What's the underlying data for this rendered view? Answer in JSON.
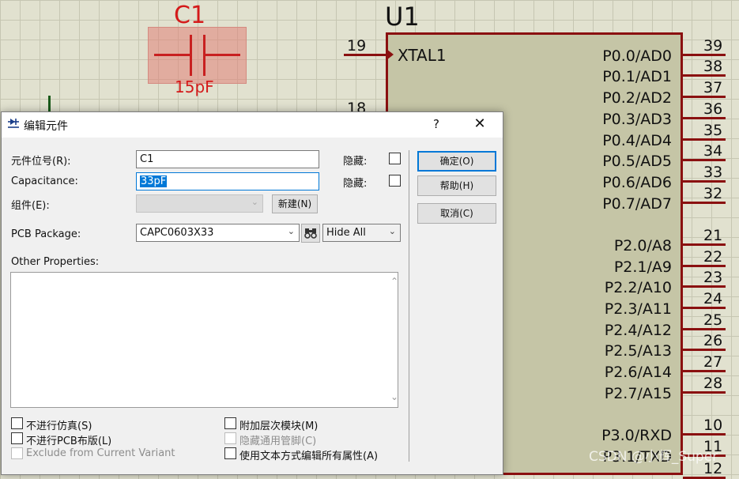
{
  "schematic": {
    "capacitor": {
      "ref": "C1",
      "value": "15pF"
    },
    "ic": {
      "ref": "U1",
      "left_pins": [
        {
          "num": "19",
          "name": "XTAL1"
        },
        {
          "num": "18",
          "name": ""
        }
      ],
      "right_pins": [
        {
          "num": "39",
          "name": "P0.0/AD0"
        },
        {
          "num": "38",
          "name": "P0.1/AD1"
        },
        {
          "num": "37",
          "name": "P0.2/AD2"
        },
        {
          "num": "36",
          "name": "P0.3/AD3"
        },
        {
          "num": "35",
          "name": "P0.4/AD4"
        },
        {
          "num": "34",
          "name": "P0.5/AD5"
        },
        {
          "num": "33",
          "name": "P0.6/AD6"
        },
        {
          "num": "32",
          "name": "P0.7/AD7"
        },
        {
          "num": "21",
          "name": "P2.0/A8"
        },
        {
          "num": "22",
          "name": "P2.1/A9"
        },
        {
          "num": "23",
          "name": "P2.2/A10"
        },
        {
          "num": "24",
          "name": "P2.3/A11"
        },
        {
          "num": "25",
          "name": "P2.4/A12"
        },
        {
          "num": "26",
          "name": "P2.5/A13"
        },
        {
          "num": "27",
          "name": "P2.6/A14"
        },
        {
          "num": "28",
          "name": "P2.7/A15"
        },
        {
          "num": "10",
          "name": "P3.0/RXD"
        },
        {
          "num": "11",
          "name": "P3.1/TXD"
        },
        {
          "num": "12",
          "name": ""
        }
      ]
    },
    "watermark": "CSDN @小辉_Super"
  },
  "dialog": {
    "title": "编辑元件",
    "title_icon": "component-icon",
    "help_label": "?",
    "close_label": "✕",
    "fields": {
      "ref_label": "元件位号(R):",
      "ref_value": "C1",
      "ref_hidden_label": "隐藏:",
      "cap_label": "Capacitance:",
      "cap_value": "33pF",
      "cap_hidden_label": "隐藏:",
      "group_label": "组件(E):",
      "group_value": "",
      "new_button": "新建(N)",
      "pcb_label": "PCB Package:",
      "pcb_value": "CAPC0603X33",
      "browse_icon": "binoculars-icon",
      "hide_select": "Hide All",
      "other_props_label": "Other Properties:",
      "other_props_value": ""
    },
    "buttons": {
      "ok": "确定(O)",
      "help": "帮助(H)",
      "cancel": "取消(C)"
    },
    "options": {
      "no_sim": "不进行仿真(S)",
      "no_pcb": "不进行PCB布版(L)",
      "exclude_variant": "Exclude from Current Variant",
      "attach_hier": "附加层次模块(M)",
      "hide_common_pins": "隐藏通用管脚(C)",
      "edit_all_text": "使用文本方式编辑所有属性(A)"
    }
  }
}
